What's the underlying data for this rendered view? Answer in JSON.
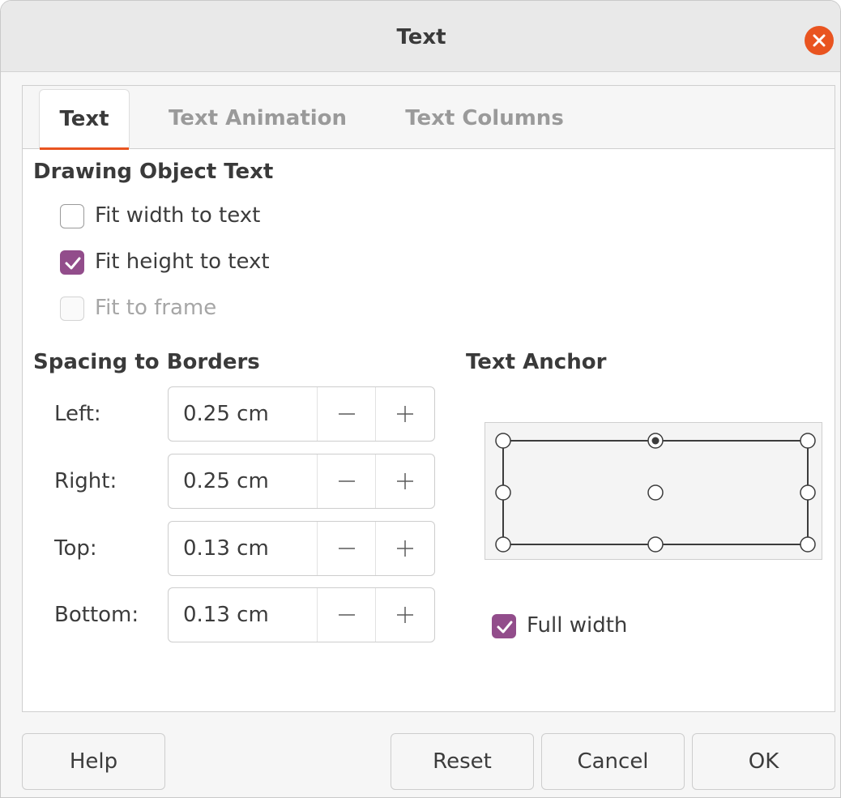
{
  "window": {
    "title": "Text"
  },
  "tabs": [
    {
      "label": "Text",
      "active": true
    },
    {
      "label": "Text Animation",
      "active": false
    },
    {
      "label": "Text Columns",
      "active": false
    }
  ],
  "drawing_object_text": {
    "heading": "Drawing Object Text",
    "fit_width": {
      "label": "Fit width to text",
      "checked": false
    },
    "fit_height": {
      "label": "Fit height to text",
      "checked": true
    },
    "fit_frame": {
      "label": "Fit to frame",
      "checked": false,
      "disabled": true
    }
  },
  "spacing": {
    "heading": "Spacing to Borders",
    "left": {
      "label": "Left:",
      "value": "0.25 cm"
    },
    "right": {
      "label": "Right:",
      "value": "0.25 cm"
    },
    "top": {
      "label": "Top:",
      "value": "0.13 cm"
    },
    "bottom": {
      "label": "Bottom:",
      "value": "0.13 cm"
    }
  },
  "anchor": {
    "heading": "Text Anchor",
    "selected": "top-center",
    "full_width": {
      "label": "Full width",
      "checked": true
    }
  },
  "buttons": {
    "help": "Help",
    "reset": "Reset",
    "cancel": "Cancel",
    "ok": "OK"
  },
  "colors": {
    "accent": "#e95420",
    "check": "#924d8b"
  }
}
